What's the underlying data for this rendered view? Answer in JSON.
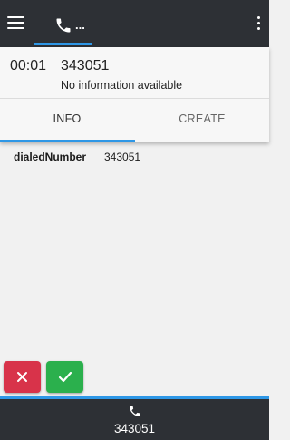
{
  "topbar": {
    "menu_icon": "hamburger-menu-icon",
    "phone_icon": "phone-icon",
    "phone_tab_ellipsis": "...",
    "overflow_icon": "kebab-menu-icon"
  },
  "call": {
    "duration": "00:01",
    "number": "343051",
    "info": "No information available"
  },
  "tabs": [
    {
      "label": "INFO",
      "active": true
    },
    {
      "label": "CREATE",
      "active": false
    }
  ],
  "info_rows": [
    {
      "key": "dialedNumber",
      "value": "343051"
    }
  ],
  "actions": {
    "reject_icon": "close-icon",
    "accept_icon": "check-icon"
  },
  "bottombar": {
    "phone_icon": "phone-icon",
    "number": "343051"
  },
  "colors": {
    "bar": "#2d3035",
    "accent": "#2e97e6",
    "reject": "#d8334a",
    "accept": "#2bb04d"
  }
}
